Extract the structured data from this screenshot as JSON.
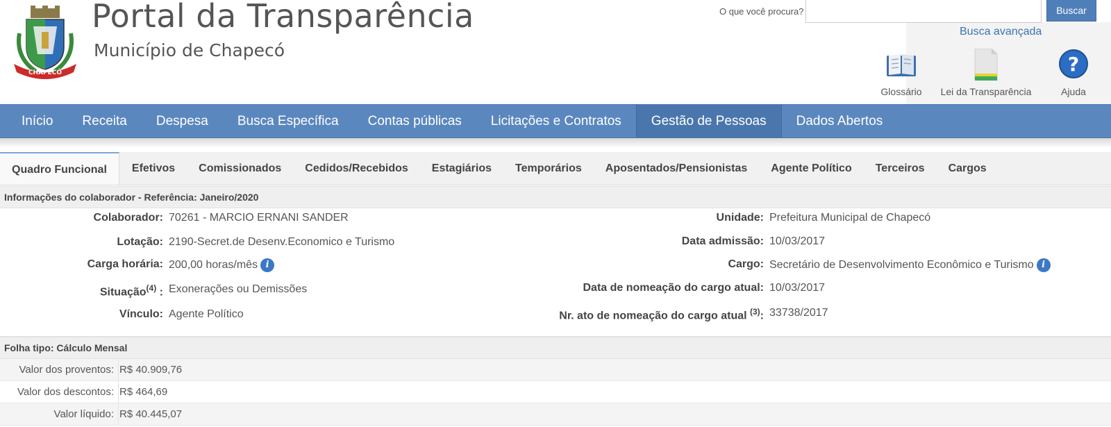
{
  "header": {
    "title": "Portal da Transparência",
    "subtitle": "Município de Chapecó",
    "logo_text": "CHAPECÓ",
    "search": {
      "label": "O que você procura?",
      "value": "",
      "button": "Buscar"
    },
    "advanced_search": "Busca avançada",
    "quick_links": [
      {
        "label": "Glossário",
        "icon": "book-icon"
      },
      {
        "label": "Lei da Transparência",
        "icon": "document-icon"
      },
      {
        "label": "Ajuda",
        "icon": "help-icon"
      }
    ]
  },
  "main_nav": {
    "items": [
      "Início",
      "Receita",
      "Despesa",
      "Busca Específica",
      "Contas públicas",
      "Licitações e Contratos",
      "Gestão de Pessoas",
      "Dados Abertos"
    ],
    "active": "Gestão de Pessoas"
  },
  "sub_tabs": {
    "items": [
      "Quadro Funcional",
      "Efetivos",
      "Comissionados",
      "Cedidos/Recebidos",
      "Estagiários",
      "Temporários",
      "Aposentados/Pensionistas",
      "Agente Político",
      "Terceiros",
      "Cargos"
    ],
    "active": "Quadro Funcional"
  },
  "info_section": {
    "title": "Informações do colaborador - Referência: Janeiro/2020",
    "left": [
      {
        "label": "Colaborador:",
        "value": "70261 - MARCIO ERNANI SANDER"
      },
      {
        "label": "Lotação:",
        "value": "2190-Secret.de Desenv.Economico e Turismo"
      },
      {
        "label": "Carga horária:",
        "value": "200,00 horas/mês"
      },
      {
        "label": "Situação",
        "sup": "(4)",
        "suffix": " :",
        "value": "Exonerações ou Demissões"
      },
      {
        "label": "Vínculo:",
        "value": "Agente Político"
      }
    ],
    "right": [
      {
        "label": "Unidade:",
        "value": "Prefeitura Municipal de Chapecó"
      },
      {
        "label": "Data admissão:",
        "value": "10/03/2017"
      },
      {
        "label": "Cargo:",
        "value": "Secretário de Desenvolvimento Econômico e Turismo"
      },
      {
        "label": "Data de nomeação do cargo atual:",
        "value": "10/03/2017"
      },
      {
        "label": "Nr. ato de nomeação do cargo atual ",
        "sup": "(3)",
        "suffix": ":",
        "value": "33738/2017"
      }
    ]
  },
  "folha_section": {
    "title": "Folha tipo: Cálculo Mensal",
    "rows": [
      {
        "label": "Valor dos proventos:",
        "value": "R$ 40.909,76"
      },
      {
        "label": "Valor dos descontos:",
        "value": "R$ 464,69"
      },
      {
        "label": "Valor líquido:",
        "value": "R$ 40.445,07"
      }
    ]
  },
  "colors": {
    "nav_bg": "#5b87bf",
    "nav_active": "#4a76ad",
    "button": "#4f7fb8",
    "link": "#3a72b5",
    "info_icon": "#3b78c6"
  }
}
